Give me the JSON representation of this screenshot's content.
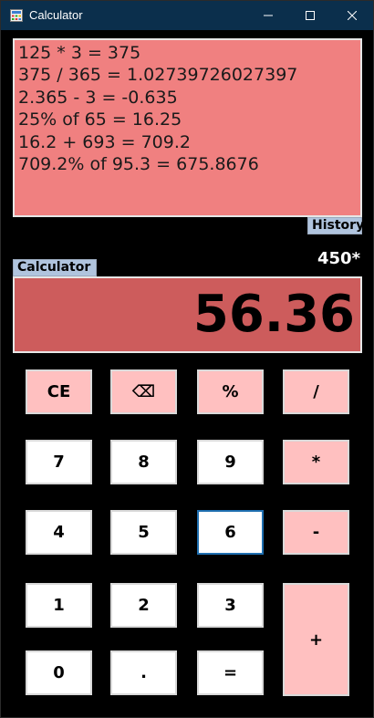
{
  "window": {
    "title": "Calculator"
  },
  "history": {
    "lines": [
      "125 * 3 = 375",
      "375 / 365 = 1.02739726027397",
      "2.365 - 3 = -0.635",
      "25% of 65 = 16.25",
      "16.2 + 693 = 709.2",
      "709.2% of 95.3 = 675.8676"
    ],
    "label": "History"
  },
  "calculator": {
    "label": "Calculator",
    "pending": "450*",
    "display": "56.36"
  },
  "keys": {
    "ce": "CE",
    "backspace": "⌫",
    "percent": "%",
    "divide": "/",
    "seven": "7",
    "eight": "8",
    "nine": "9",
    "multiply": "*",
    "four": "4",
    "five": "5",
    "six": "6",
    "minus": "-",
    "one": "1",
    "two": "2",
    "three": "3",
    "plus": "+",
    "zero": "0",
    "dot": ".",
    "equals": "="
  },
  "colors": {
    "titlebar": "#0b2f4c",
    "history_bg": "#f08080",
    "display_bg": "#cd5c5c",
    "key_pink": "#ffc0c0",
    "key_white": "#ffffff",
    "tag_bg": "#b0c4de"
  },
  "icons": {
    "app": "calculator-app-icon",
    "minimize": "minimize-icon",
    "maximize": "maximize-icon",
    "close": "close-icon"
  }
}
